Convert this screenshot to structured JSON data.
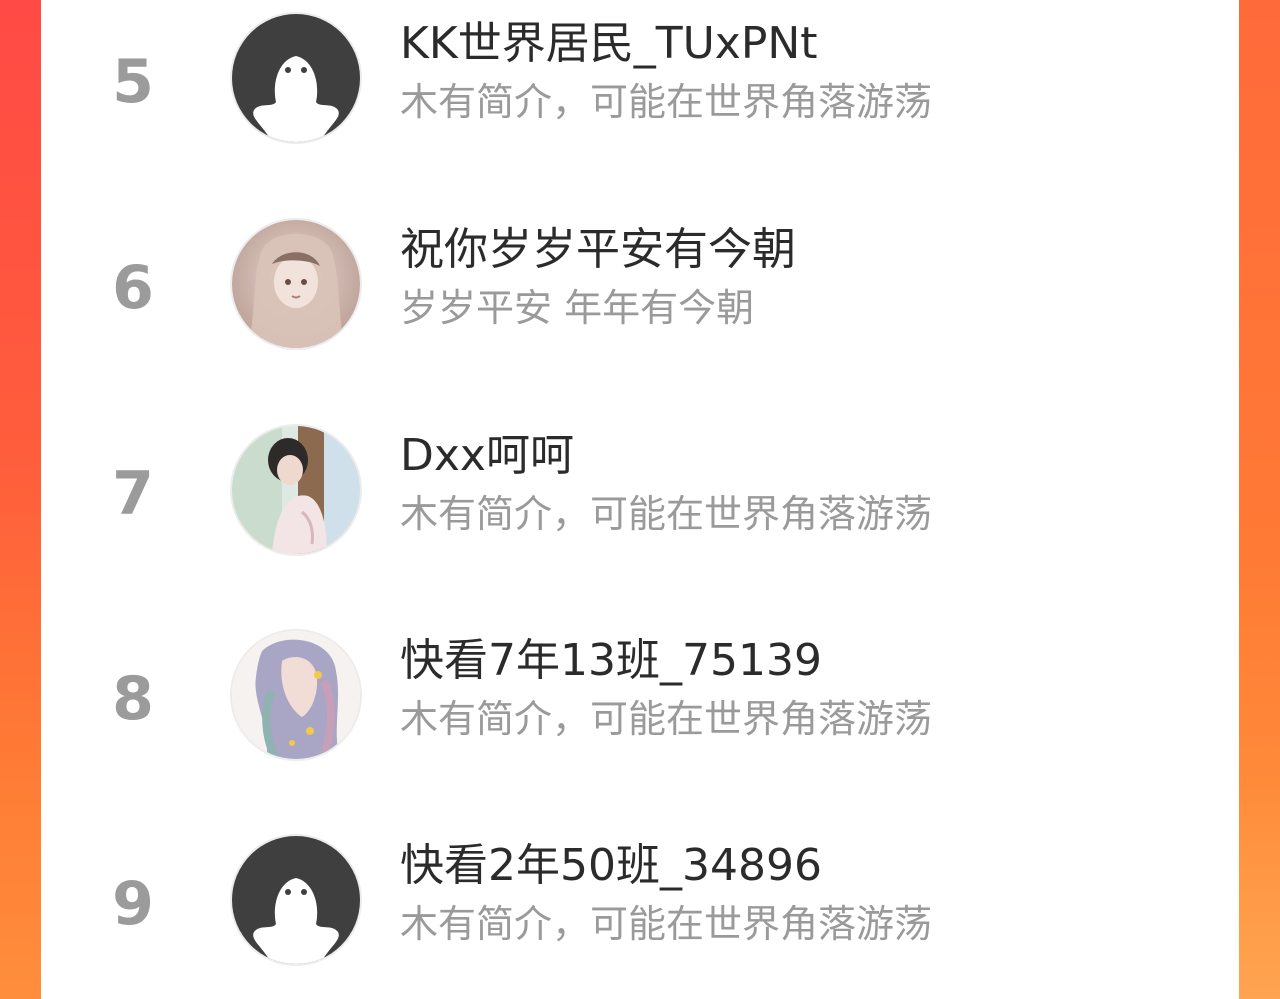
{
  "leaderboard": {
    "rows": [
      {
        "rank": "5",
        "name": "KK世界居民_TUxPNt",
        "bio": "木有简介，可能在世界角落游荡",
        "avatar_icon": "default-ghost-avatar-icon"
      },
      {
        "rank": "6",
        "name": "祝你岁岁平安有今朝",
        "bio": "岁岁平安 年年有今朝",
        "avatar_icon": "user-photo-avatar"
      },
      {
        "rank": "7",
        "name": "Dxx呵呵",
        "bio": "木有简介，可能在世界角落游荡",
        "avatar_icon": "user-photo-avatar"
      },
      {
        "rank": "8",
        "name": "快看7年13班_75139",
        "bio": "木有简介，可能在世界角落游荡",
        "avatar_icon": "user-photo-avatar"
      },
      {
        "rank": "9",
        "name": "快看2年50班_34896",
        "bio": "木有简介，可能在世界角落游荡",
        "avatar_icon": "default-ghost-avatar-icon"
      }
    ]
  },
  "colors": {
    "background_gradient_top": "#ff4a45",
    "background_gradient_bottom": "#ff8e3c",
    "rank_color": "#9b9b9b",
    "name_color": "#2b2b2b",
    "bio_color": "#9a9a9a",
    "default_avatar_fill": "#3f3f3f"
  }
}
